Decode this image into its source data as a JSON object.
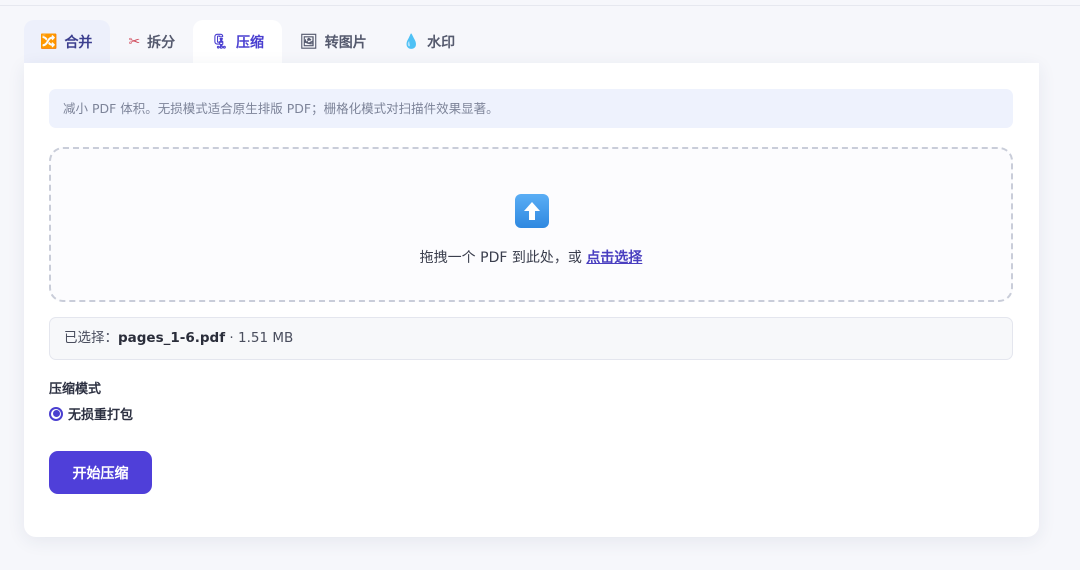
{
  "tabs": [
    {
      "label": "合并",
      "icon": "shuffle-icon",
      "glyph": "🔀"
    },
    {
      "label": "拆分",
      "icon": "scissors-icon",
      "glyph": "✂"
    },
    {
      "label": "压缩",
      "icon": "clamp-icon",
      "glyph": "🗜"
    },
    {
      "label": "转图片",
      "icon": "picture-icon",
      "glyph": "🖼"
    },
    {
      "label": "水印",
      "icon": "droplet-icon",
      "glyph": "💧"
    }
  ],
  "active_tab": "压缩",
  "info_text": "减小 PDF 体积。无损模式适合原生排版 PDF；栅格化模式对扫描件效果显著。",
  "dropzone": {
    "text": "拖拽一个 PDF 到此处，或 ",
    "link": "点击选择"
  },
  "selected_file": {
    "prefix": "已选择：",
    "name": "pages_1-6.pdf",
    "size": " · 1.51 MB"
  },
  "compress_mode": {
    "title": "压缩模式",
    "option": "无损重打包",
    "checked": true
  },
  "start_button": "开始压缩",
  "colors": {
    "accent": "#4f3fd9",
    "info_bg": "#eef2fd"
  }
}
